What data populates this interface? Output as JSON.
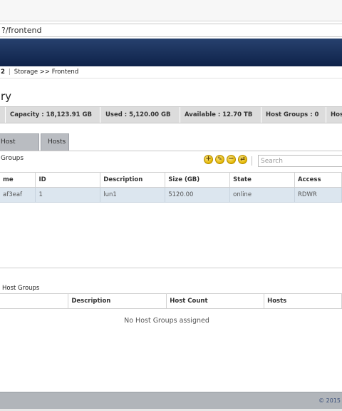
{
  "browser": {
    "address_text": "?/frontend"
  },
  "breadcrumb": {
    "prefix": "2",
    "path": "Storage >> Frontend"
  },
  "page_title": "ry",
  "summary": {
    "capacity": "Capacity : 18,123.91 GB",
    "used": "Used : 5,120.00 GB",
    "available": "Available : 12.70 TB",
    "host_groups": "Host Groups : 0",
    "hosts": "Hos"
  },
  "tabs": [
    {
      "label": "Host Groups"
    },
    {
      "label": "Hosts"
    }
  ],
  "toolbar": {
    "icons": [
      "add-icon",
      "edit-icon",
      "remove-icon",
      "map-icon"
    ],
    "search_placeholder": "Search"
  },
  "lun_table": {
    "columns": [
      "me",
      "ID",
      "Description",
      "Size (GB)",
      "State",
      "Access"
    ],
    "rows": [
      [
        "af3eaf",
        "1",
        "lun1",
        "5120.00",
        "online",
        "RDWR"
      ]
    ]
  },
  "host_groups_panel": {
    "title": "Host Groups",
    "columns": [
      "",
      "Description",
      "Host Count",
      "Hosts"
    ],
    "empty_message": "No Host Groups assigned"
  },
  "footer": {
    "text": "© 2015"
  }
}
